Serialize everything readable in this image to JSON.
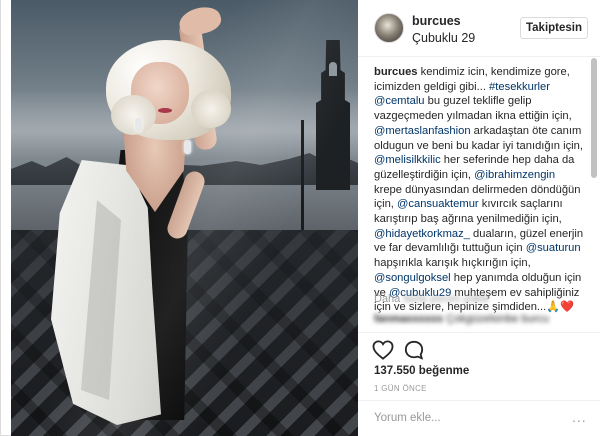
{
  "post": {
    "username": "burcues",
    "location": "Çubuklu 29",
    "follow_label": "Takiptesin",
    "caption": {
      "segments": [
        {
          "t": "burcues",
          "k": "u"
        },
        {
          "t": " kendimiz icin, kendimize gore, icimizden geldigi gibi... ",
          "k": "n"
        },
        {
          "t": "#tesekkurler",
          "k": "m"
        },
        {
          "t": " ",
          "k": "n"
        },
        {
          "t": "@cemtalu",
          "k": "m"
        },
        {
          "t": " bu guzel teklifle gelip vazgeçmeden yılmadan ikna ettiğin için, ",
          "k": "n"
        },
        {
          "t": "@mertaslanfashion",
          "k": "m"
        },
        {
          "t": " arkadaştan öte canım oldugun ve beni bu kadar iyi tanıdığın için, ",
          "k": "n"
        },
        {
          "t": "@melisilkkilic",
          "k": "m"
        },
        {
          "t": " her seferinde hep daha da güzelleştirdiğin için, ",
          "k": "n"
        },
        {
          "t": "@ibrahimzengin",
          "k": "m"
        },
        {
          "t": " krepe dünyasından delirmeden döndüğün için, ",
          "k": "n"
        },
        {
          "t": "@cansuaktemur",
          "k": "m"
        },
        {
          "t": " kıvırcık saçlarını karıştırıp baş ağrına yenilmediğin için, ",
          "k": "n"
        },
        {
          "t": "@hidayetkorkmaz_",
          "k": "m"
        },
        {
          "t": " duaların, güzel enerjin ve far devamlılığı tuttuğun için ",
          "k": "n"
        },
        {
          "t": "@suaturun",
          "k": "m"
        },
        {
          "t": " hapşırıkla karışık hıçkırığın için, ",
          "k": "n"
        },
        {
          "t": "@songulgoksel",
          "k": "m"
        },
        {
          "t": " hep yanımda olduğun için ve ",
          "k": "n"
        },
        {
          "t": "@cubuklu29",
          "k": "m"
        },
        {
          "t": " muhteşem ev sahipliğiniz için ve sizlere, hepinize şimdiden...🙏❤️",
          "k": "n"
        }
      ]
    },
    "more_comments_prefix": "Daha",
    "more_comments_hidden": "fazla yorum yükle",
    "comment_user_hidden": "fanmaxxxxxx",
    "comment_text_hidden": "Çokgüzelsinbe burcu",
    "likes": "137.550 beğenme",
    "time_ago": "1 GÜN ÖNCE",
    "comment_placeholder": "Yorum ekle...",
    "more_options": "..."
  },
  "colors": {
    "mention": "#003569",
    "muted": "#999999",
    "border": "#dbdbdb"
  },
  "icons": {
    "like": "heart-icon",
    "comment": "comment-icon",
    "options": "more-options-icon"
  }
}
